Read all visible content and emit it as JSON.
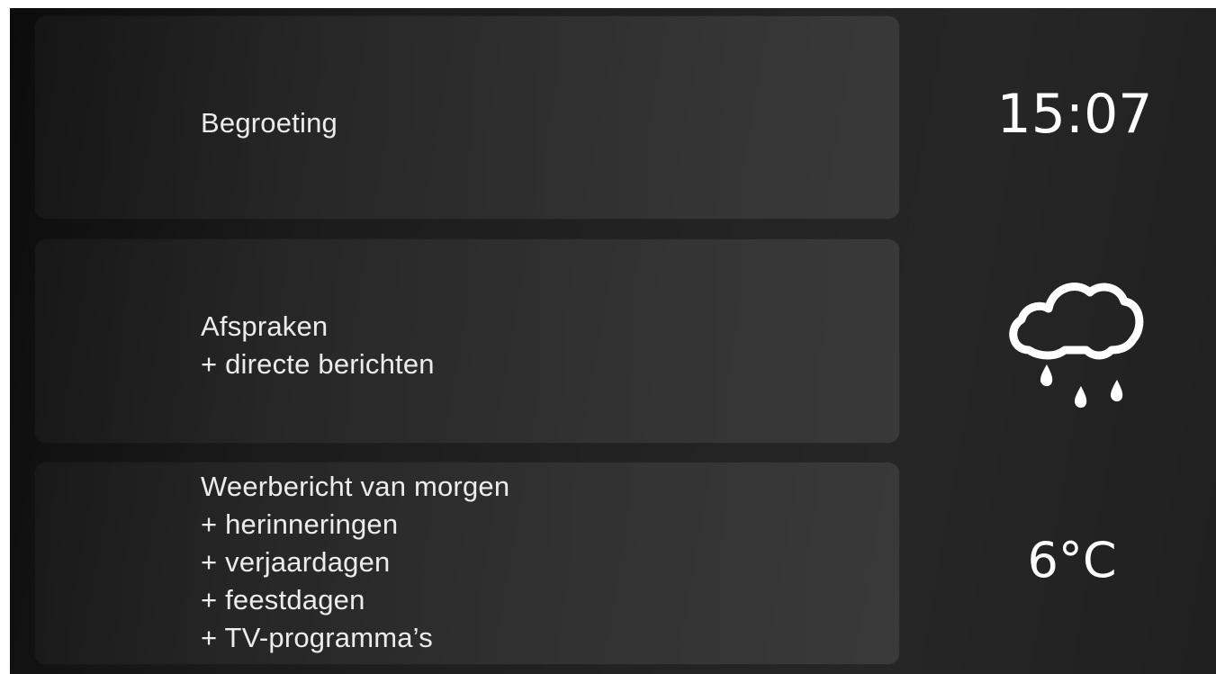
{
  "panels": [
    {
      "lines": [
        "Begroeting"
      ]
    },
    {
      "lines": [
        "Afspraken",
        "+ directe berichten"
      ]
    },
    {
      "lines": [
        "Weerbericht van morgen",
        "+ herinneringen",
        "+ verjaardagen",
        "+ feestdagen",
        "+ TV-programma’s"
      ]
    }
  ],
  "status": {
    "time": "15:07",
    "weather_icon": "rain-cloud-icon",
    "temperature": "6°C"
  },
  "colors": {
    "background_dark": "#0c0c0c",
    "background_light": "#262626",
    "text": "#ffffff"
  }
}
